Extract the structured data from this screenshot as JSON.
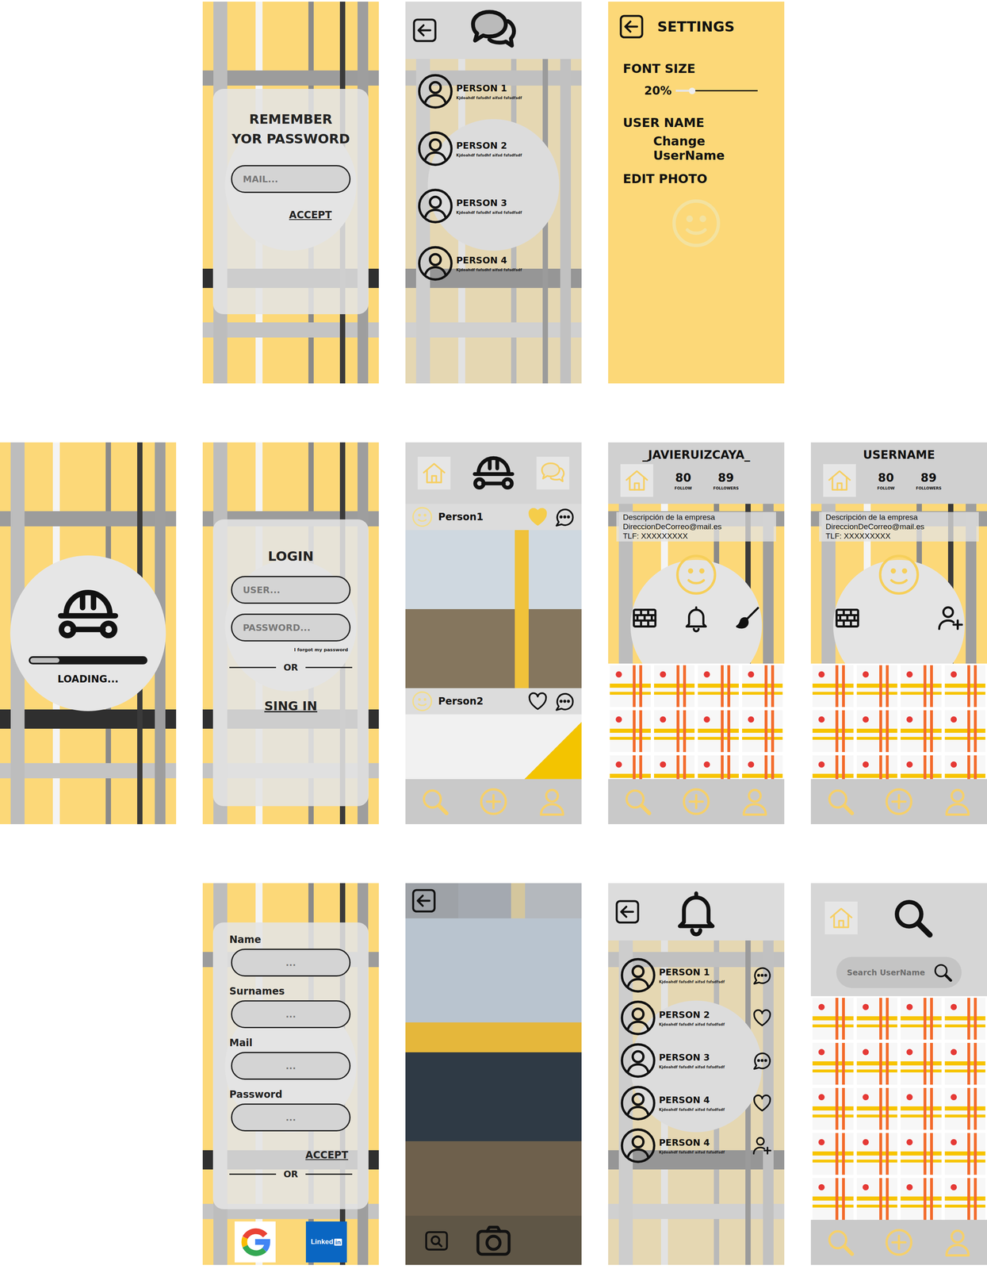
{
  "remember_password": {
    "title_lines": [
      "REMEMBER",
      "YOR PASSWORD"
    ],
    "mail_placeholder": "MAIL...",
    "accept": "ACCEPT"
  },
  "chats": {
    "items": [
      {
        "name": "PERSON 1",
        "preview": "Kjdoahdf fafsdhf aifsd fsfsdfsdf"
      },
      {
        "name": "PERSON 2",
        "preview": "Kjdoahdf fafsdhf aifsd fsfsdfsdf"
      },
      {
        "name": "PERSON 3",
        "preview": "Kjdoahdf fafsdhf aifsd fsfsdfsdf"
      },
      {
        "name": "PERSON 4",
        "preview": "Kjdoahdf fafsdhf aifsd fsfsdfsdf"
      }
    ]
  },
  "settings": {
    "title": "SETTINGS",
    "font_size_label": "FONT SIZE",
    "font_size_reading": "20%",
    "font_size_level": 0.2,
    "user_name_label": "USER NAME",
    "change_username": "Change UserName",
    "edit_photo": "EDIT PHOTO"
  },
  "loading": {
    "label": "LOADING...",
    "level": 0.25
  },
  "login": {
    "title": "LOGIN",
    "user_placeholder": "USER...",
    "password_placeholder": "PASSWORD...",
    "forgot": "I forgot my password",
    "or": "OR",
    "sign_in": "SING IN"
  },
  "feed": {
    "posts": [
      {
        "author": "Person1",
        "liked": true
      },
      {
        "author": "Person2",
        "liked": false
      }
    ]
  },
  "own_profile": {
    "username": "_JAVIERUIZCAYA_",
    "stats": [
      {
        "value": "80",
        "label": "FOLLOW"
      },
      {
        "value": "89",
        "label": "FOLLOWERS"
      }
    ],
    "description": [
      "Descripción de la empresa",
      "DireccionDeCorreo@mail.es",
      "TLF: XXXXXXXXX"
    ],
    "thumbnails": 12
  },
  "other_profile": {
    "username": "USERNAME",
    "stats": [
      {
        "value": "80",
        "label": "FOLLOW"
      },
      {
        "value": "89",
        "label": "FOLLOWERS"
      }
    ],
    "description": [
      "Descripción de la empresa",
      "DireccionDeCorreo@mail.es",
      "TLF: XXXXXXXXX"
    ],
    "thumbnails": 12
  },
  "register": {
    "fields": [
      {
        "label": "Name",
        "placeholder": "..."
      },
      {
        "label": "Surnames",
        "placeholder": "..."
      },
      {
        "label": "Mail",
        "placeholder": "..."
      },
      {
        "label": "Password",
        "placeholder": "..."
      }
    ],
    "accept": "ACCEPT",
    "or": "OR",
    "linkedin": {
      "word": "Linked",
      "badge": "in"
    }
  },
  "notifications": {
    "items": [
      {
        "name": "PERSON 1",
        "preview": "Kjdoahdf fafsdhf aifsd fsfsdfsdf",
        "kind": "comment"
      },
      {
        "name": "PERSON 2",
        "preview": "Kjdoahdf fafsdhf aifsd fsfsdfsdf",
        "kind": "like"
      },
      {
        "name": "PERSON 3",
        "preview": "Kjdoahdf fafsdhf aifsd fsfsdfsdf",
        "kind": "comment"
      },
      {
        "name": "PERSON 4",
        "preview": "Kjdoahdf fafsdhf aifsd fsfsdfsdf",
        "kind": "like"
      },
      {
        "name": "PERSON 4",
        "preview": "Kjdoahdf fafsdhf aifsd fsfsdfsdf",
        "kind": "follow"
      }
    ]
  },
  "search": {
    "placeholder": "Search UserName",
    "thumbnails": 20
  }
}
